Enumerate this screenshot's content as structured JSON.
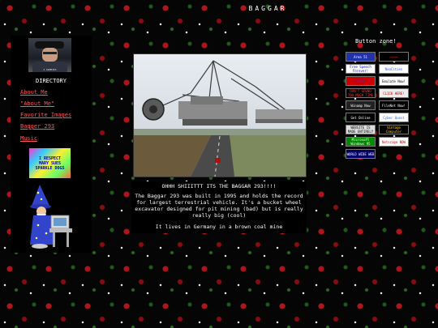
{
  "page": {
    "title": "BAGGAR"
  },
  "sidebar": {
    "avatar_text": "4 DUMMIES",
    "directory_label": "DIRECTORY",
    "links": [
      {
        "label": "About Me"
      },
      {
        "label": "\"About Me\""
      },
      {
        "label": "Favorite Images"
      },
      {
        "label": "Bagger 293"
      },
      {
        "label": "Music"
      }
    ],
    "sparkle_badge": {
      "line1": "I RESPECT",
      "line2": "MARY SUES",
      "line3": "SPARKLE DOGS"
    }
  },
  "main": {
    "caption_title": "OHHH SHIIITTT ITS THE BAGGAR 293!!!!",
    "caption_description": "The Baggar 293 was built in 1995 and holds the record for largest terrestrial vehicle. It's a bucket wheel excavator designed for pit mining (bad) but is really really big (cool)",
    "caption_location": "It lives in Germany in a brown coal mine"
  },
  "button_zone": {
    "label": "Button zone!",
    "buttons": [
      {
        "label": "Area 51",
        "color": "#2233aa",
        "text_color": "#ffffff",
        "icon": "alien-icon"
      },
      {
        "label": "~~~~",
        "color": "#000000",
        "text_color": "#ff2222",
        "icon": "waveform-icon"
      },
      {
        "label": "Free Speech Forever!",
        "color": "#ffffff",
        "text_color": "#0000cc",
        "icon": "ribbon-icon"
      },
      {
        "label": "NeoCities",
        "color": "#ffffff",
        "text_color": "#3355ff",
        "icon": "neocities-icon"
      },
      {
        "label": "XXXX",
        "color": "#cc0000",
        "text_color": "#3333ff",
        "icon": "blue-text-icon"
      },
      {
        "label": "Emulate Now!",
        "color": "#ffffff",
        "text_color": "#000000",
        "icon": "emulator-icon"
      },
      {
        "label": "DON'T SPEND TOO MUCH TIME",
        "color": "#000000",
        "text_color": "#ff3333",
        "icon": "warning-icon"
      },
      {
        "label": "CLICK HERE!",
        "color": "#eeeeee",
        "text_color": "#cc0000",
        "icon": "click-icon"
      },
      {
        "label": "Winamp Now",
        "color": "#222222",
        "text_color": "#ffffff",
        "icon": "winamp-icon"
      },
      {
        "label": "FileNet Now!",
        "color": "#000000",
        "text_color": "#ffffff",
        "icon": "filenet-icon"
      },
      {
        "label": "Get Online",
        "color": "#000000",
        "text_color": "#ffffff",
        "icon": "hat-icon"
      },
      {
        "label": "Cyber Quest",
        "color": "#ffffff",
        "text_color": "#3366cc",
        "icon": "cyber-icon"
      },
      {
        "label": "WEBSITE IS MADE ENTIRELY",
        "color": "#dddddd",
        "text_color": "#000000",
        "icon": "web-icon"
      },
      {
        "label": "Vintage Computer",
        "color": "#000000",
        "text_color": "#ffcc00",
        "icon": "computer-icon"
      },
      {
        "label": "Microsoft Windows 95",
        "color": "#008800",
        "text_color": "#ffffff",
        "icon": "windows-icon"
      },
      {
        "label": "Netscape NOW",
        "color": "#ffffff",
        "text_color": "#cc0000",
        "icon": "netscape-icon"
      },
      {
        "label": "WORLD WIDE WEB",
        "color": "#000066",
        "text_color": "#ffffff",
        "icon": "globe-icon"
      }
    ]
  }
}
